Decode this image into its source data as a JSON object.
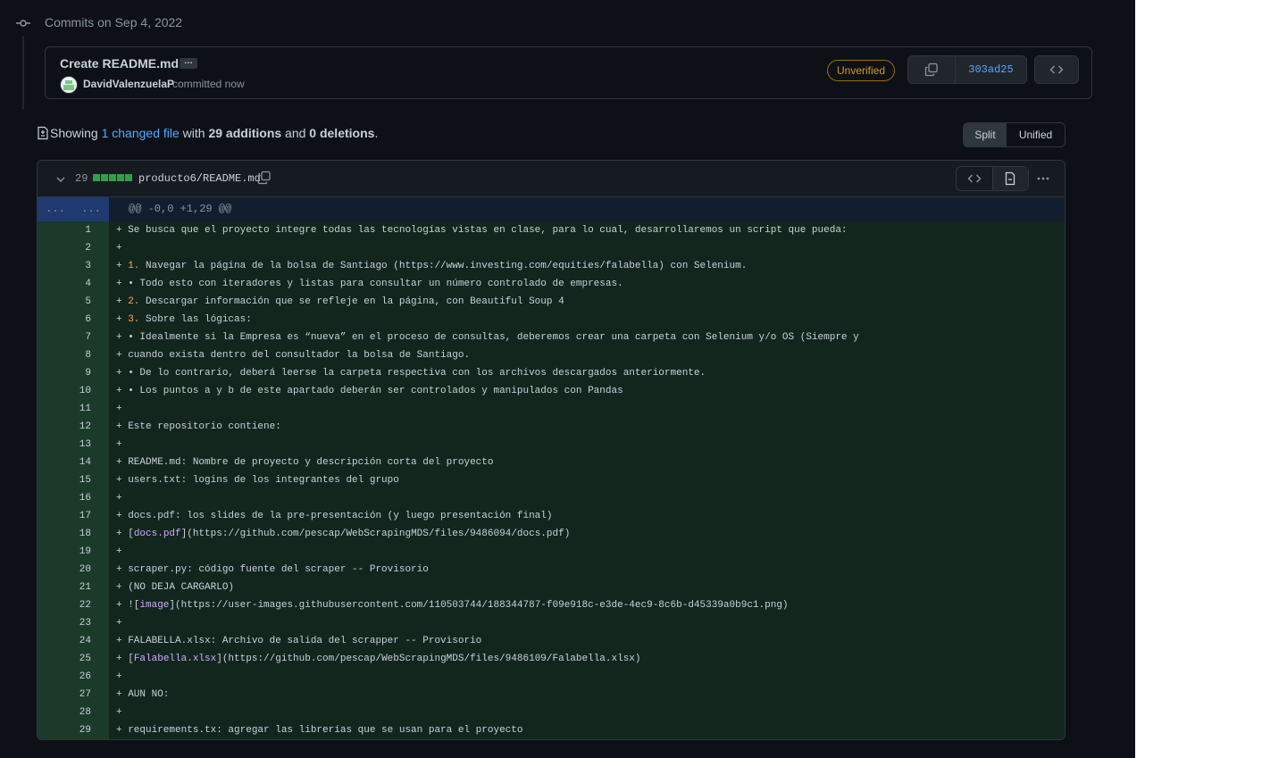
{
  "timeline": {
    "date_label": "Commits on Sep 4, 2022"
  },
  "commit": {
    "title": "Create README.md",
    "ellipsis": "…",
    "author": "DavidValenzuelaP",
    "committed": "committed now",
    "badge": "Unverified",
    "sha": "303ad25"
  },
  "summary": {
    "prefix": "Showing",
    "changed": "1 changed file",
    "with": "with",
    "additions": "29 additions",
    "and": "and",
    "deletions": "0 deletions",
    "period": "."
  },
  "view_toggle": {
    "split": "Split",
    "unified": "Unified"
  },
  "file": {
    "diffstat": "29",
    "name": "producto6/README.md",
    "hunk_left": "...",
    "hunk_right": "...",
    "hunk_header": "@@ -0,0 +1,29 @@"
  },
  "lines": [
    {
      "n": "1",
      "t": "+ Se busca que el proyecto integre todas las tecnologías vistas en clase, para lo cual, desarrollaremos un script que pueda:"
    },
    {
      "n": "2",
      "t": "+"
    },
    {
      "n": "3",
      "pre": "+ ",
      "hl": "1.",
      "post": " Navegar la página de la bolsa de Santiago (https://www.investing.com/equities/falabella) con Selenium."
    },
    {
      "n": "4",
      "t": "+ • Todo esto con iteradores y listas para consultar un número controlado de empresas."
    },
    {
      "n": "5",
      "pre": "+ ",
      "hl": "2.",
      "post": " Descargar información que se refleje en la página, con Beautiful Soup 4"
    },
    {
      "n": "6",
      "pre": "+ ",
      "hl": "3.",
      "post": " Sobre las lógicas:"
    },
    {
      "n": "7",
      "t": "+ • Idealmente si la Empresa es “nueva” en el proceso de consultas, deberemos crear una carpeta con Selenium y/o OS (Siempre y"
    },
    {
      "n": "8",
      "t": "+ cuando exista dentro del consultador la bolsa de Santiago."
    },
    {
      "n": "9",
      "t": "+ • De lo contrario, deberá leerse la carpeta respectiva con los archivos descargados anteriormente."
    },
    {
      "n": "10",
      "t": "+ • Los puntos a y b de este apartado deberán ser controlados y manipulados con Pandas"
    },
    {
      "n": "11",
      "t": "+"
    },
    {
      "n": "12",
      "t": "+ Este repositorio contiene:"
    },
    {
      "n": "13",
      "t": "+"
    },
    {
      "n": "14",
      "t": "+ README.md: Nombre de proyecto y descripción corta del proyecto"
    },
    {
      "n": "15",
      "t": "+ users.txt: logins de los integrantes del grupo"
    },
    {
      "n": "16",
      "t": "+"
    },
    {
      "n": "17",
      "t": "+ docs.pdf: los slides de la pre-presentación (y luego presentación final)"
    },
    {
      "n": "18",
      "pre": "+ [",
      "hlp": "docs.pdf",
      "post": "](https://github.com/pescap/WebScrapingMDS/files/9486094/docs.pdf)"
    },
    {
      "n": "19",
      "t": "+"
    },
    {
      "n": "20",
      "t": "+ scraper.py: código fuente del scraper -- Provisorio"
    },
    {
      "n": "21",
      "t": "+ (NO DEJA CARGARLO)"
    },
    {
      "n": "22",
      "pre": "+ ![",
      "hlp": "image",
      "post": "](https://user-images.githubusercontent.com/110503744/188344787-f09e918c-e3de-4ec9-8c6b-d45339a0b9c1.png)"
    },
    {
      "n": "23",
      "t": "+"
    },
    {
      "n": "24",
      "t": "+ FALABELLA.xlsx: Archivo de salida del scrapper -- Provisorio"
    },
    {
      "n": "25",
      "pre": "+ [",
      "hlp": "Falabella.xlsx",
      "post": "](https://github.com/pescap/WebScrapingMDS/files/9486109/Falabella.xlsx)"
    },
    {
      "n": "26",
      "t": "+"
    },
    {
      "n": "27",
      "t": "+ AUN NO:"
    },
    {
      "n": "28",
      "t": "+"
    },
    {
      "n": "29",
      "t": "+ requirements.tx: agregar las librerías que se usan para el proyecto"
    }
  ]
}
